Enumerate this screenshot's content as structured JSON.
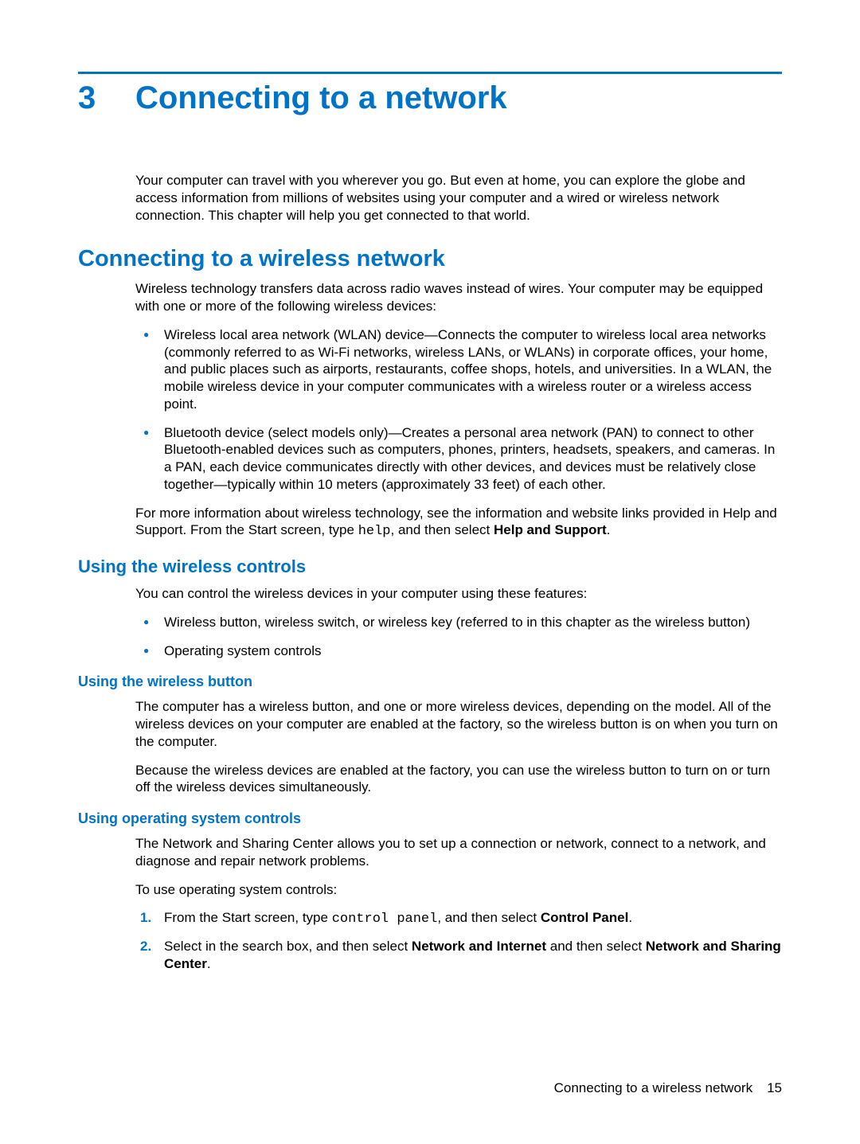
{
  "chapter": {
    "number": "3",
    "title": "Connecting to a network"
  },
  "intro": "Your computer can travel with you wherever you go. But even at home, you can explore the globe and access information from millions of websites using your computer and a wired or wireless network connection. This chapter will help you get connected to that world.",
  "section1": {
    "title": "Connecting to a wireless network",
    "intro": "Wireless technology transfers data across radio waves instead of wires. Your computer may be equipped with one or more of the following wireless devices:",
    "bullets": [
      "Wireless local area network (WLAN) device—Connects the computer to wireless local area networks (commonly referred to as Wi-Fi networks, wireless LANs, or WLANs) in corporate offices, your home, and public places such as airports, restaurants, coffee shops, hotels, and universities. In a WLAN, the mobile wireless device in your computer communicates with a wireless router or a wireless access point.",
      "Bluetooth device (select models only)—Creates a personal area network (PAN) to connect to other Bluetooth-enabled devices such as computers, phones, printers, headsets, speakers, and cameras. In a PAN, each device communicates directly with other devices, and devices must be relatively close together—typically within 10 meters (approximately 33 feet) of each other."
    ],
    "moreinfo_pre": "For more information about wireless technology, see the information and website links provided in Help and Support. From the Start screen, type ",
    "moreinfo_code": "help",
    "moreinfo_post1": ", and then select ",
    "moreinfo_bold": "Help and Support",
    "moreinfo_post2": "."
  },
  "section2": {
    "title": "Using the wireless controls",
    "intro": "You can control the wireless devices in your computer using these features:",
    "bullets": [
      "Wireless button, wireless switch, or wireless key (referred to in this chapter as the wireless button)",
      "Operating system controls"
    ]
  },
  "section3": {
    "title": "Using the wireless button",
    "para1": "The computer has a wireless button, and one or more wireless devices, depending on the model. All of the wireless devices on your computer are enabled at the factory, so the wireless button is on when you turn on the computer.",
    "para2": "Because the wireless devices are enabled at the factory, you can use the wireless button to turn on or turn off the wireless devices simultaneously."
  },
  "section4": {
    "title": "Using operating system controls",
    "para1": "The Network and Sharing Center allows you to set up a connection or network, connect to a network, and diagnose and repair network problems.",
    "para2": "To use operating system controls:",
    "step1_pre": "From the Start screen, type ",
    "step1_code": "control panel",
    "step1_post1": ", and then select ",
    "step1_bold": "Control Panel",
    "step1_post2": ".",
    "step2_pre": "Select in the search box, and then select ",
    "step2_bold1": "Network and Internet",
    "step2_mid": " and then select ",
    "step2_bold2": "Network and Sharing Center",
    "step2_post": "."
  },
  "footer": {
    "label": "Connecting to a wireless network",
    "page": "15"
  }
}
